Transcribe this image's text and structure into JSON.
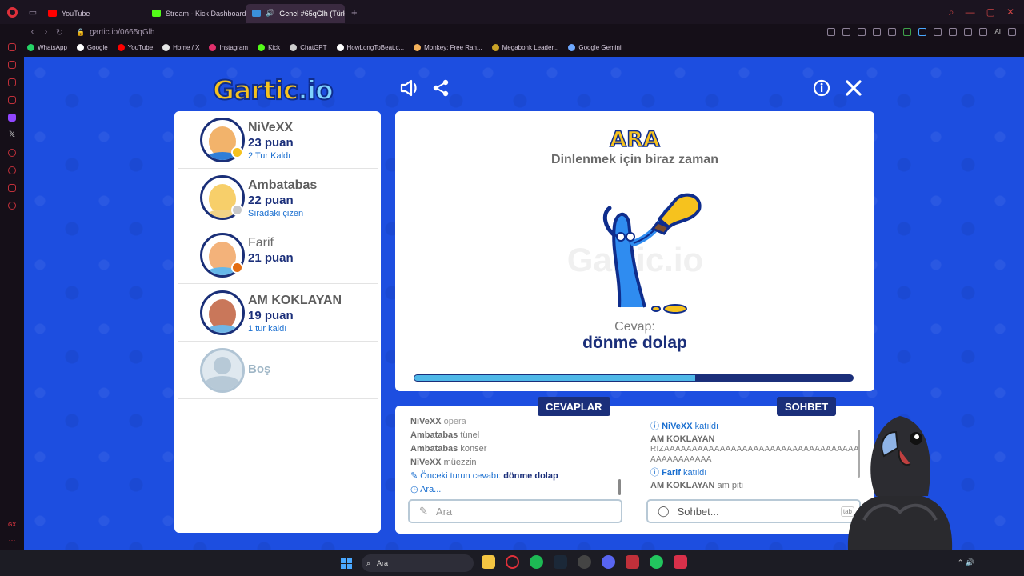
{
  "browser": {
    "tabs": [
      {
        "title": "YouTube",
        "color": "#ff0000",
        "active": false
      },
      {
        "title": "Stream - Kick Dashboard",
        "color": "#53fc18",
        "active": false
      },
      {
        "title": "Genel #65qGlh (Türkç",
        "color": "#3a8fd9",
        "active": true
      }
    ],
    "url": "gartic.io/0665qGlh",
    "bookmarks": [
      {
        "label": "WhatsApp",
        "color": "#25d366"
      },
      {
        "label": "Google",
        "color": "#ffffff"
      },
      {
        "label": "YouTube",
        "color": "#ff0000"
      },
      {
        "label": "Home / X",
        "color": "#e6e6e6"
      },
      {
        "label": "Instagram",
        "color": "#e1306c"
      },
      {
        "label": "Kick",
        "color": "#53fc18"
      },
      {
        "label": "ChatGPT",
        "color": "#cccccc"
      },
      {
        "label": "HowLongToBeat.c...",
        "color": "#ffffff"
      },
      {
        "label": "Monkey: Free Ran...",
        "color": "#f3b15b"
      },
      {
        "label": "Megabonk Leader...",
        "color": "#c9a227"
      },
      {
        "label": "Google Gemini",
        "color": "#6ea8ff"
      }
    ],
    "ai_label": "AI"
  },
  "game": {
    "logo_main": "Gartic",
    "logo_io": ".io",
    "players": [
      {
        "name": "NiVeXX",
        "points": "23 puan",
        "status": "2 Tur Kaldı",
        "badge": "#f6c21e",
        "skin": "#f2b36b",
        "shirt": "#2f7ed8"
      },
      {
        "name": "Ambatabas",
        "points": "22 puan",
        "status": "Sıradaki çizen",
        "badge": "#c8c8c8",
        "skin": "#f7cf6a",
        "shirt": "#f2d487"
      },
      {
        "name": "Farif",
        "points": "21 puan",
        "status": "",
        "badge": "#e46d12",
        "skin": "#f3b27a",
        "shirt": "#66b8e8"
      },
      {
        "name": "AM KOKLAYAN",
        "points": "19 puan",
        "status": "1 tur kaldı",
        "badge": "",
        "skin": "#c9775a",
        "shirt": "#6fb6e6"
      }
    ],
    "empty_slot": "Boş",
    "stage": {
      "title": "ARA",
      "subtitle": "Dinlenmek için biraz zaman",
      "answer_label": "Cevap:",
      "answer": "dönme dolap",
      "progress": 0.64
    },
    "answers_tab": "CEVAPLAR",
    "chat_tab": "SOHBET",
    "answers": [
      {
        "user": "NiVeXX",
        "text": "opera"
      },
      {
        "user": "Ambatabas",
        "text": "tünel"
      },
      {
        "user": "Ambatabas",
        "text": "konser"
      },
      {
        "user": "NiVeXX",
        "text": "müezzin"
      }
    ],
    "prev_answer_label": "Önceki turun cevabı:",
    "prev_answer": "dönme dolap",
    "searching": "Ara...",
    "chat": [
      {
        "user": "NiVeXX",
        "text": "katıldı",
        "system": true
      },
      {
        "user": "AM KOKLAYAN",
        "text": "RIZAAAAAAAAAAAAAAAAAAAAAAAAAAAAAAAAAAAAAAAAAAAAAA",
        "system": false
      },
      {
        "user": "Farif",
        "text": "katıldı",
        "system": true
      },
      {
        "user": "AM KOKLAYAN",
        "text": "am piti",
        "system": false
      }
    ],
    "guess_placeholder": "Ara",
    "chat_placeholder": "Sohbet...",
    "tab_key": "tab"
  },
  "taskbar": {
    "search": "Ara"
  }
}
